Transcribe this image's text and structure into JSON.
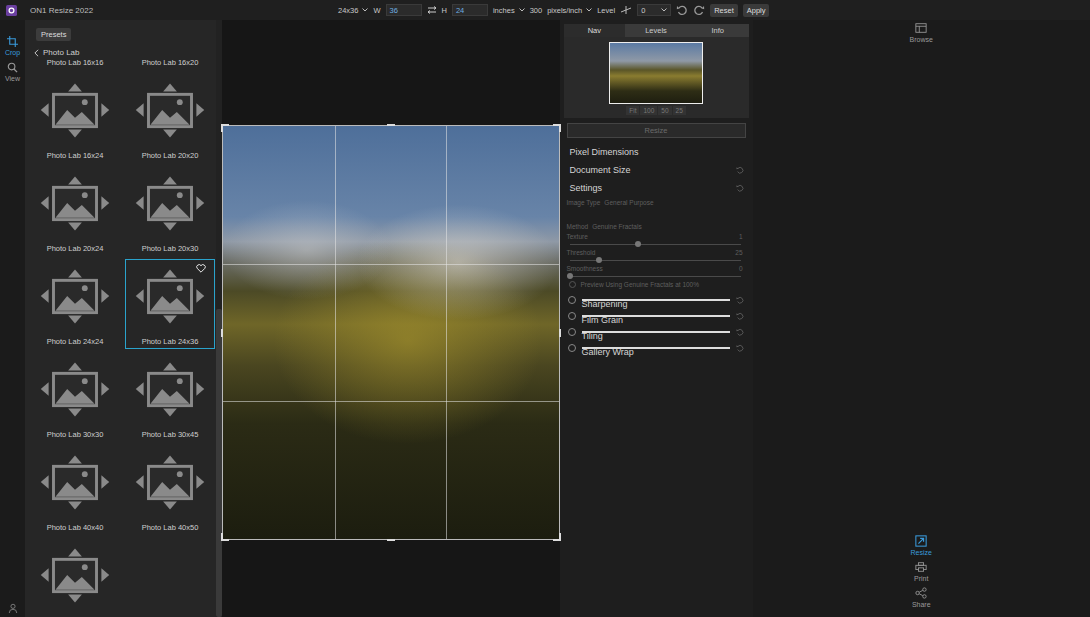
{
  "window": {
    "title": "ON1 Resize 2022"
  },
  "toolbar": {
    "preset": "24x36",
    "width_label": "W",
    "width": "36",
    "height_label": "H",
    "height": "24",
    "units": "inches",
    "resolution": "300",
    "resolution_units": "pixels/inch",
    "level_label": "Level",
    "level": "0",
    "reset": "Reset",
    "apply": "Apply"
  },
  "left_tools": [
    {
      "label": "Crop",
      "selected": true
    },
    {
      "label": "View",
      "selected": false
    }
  ],
  "presets_panel": {
    "button": "Presets",
    "title": "Photo Lab",
    "items": [
      {
        "label": "Photo Lab 16x16",
        "selected": false,
        "favorite": false
      },
      {
        "label": "Photo Lab 16x20",
        "selected": false,
        "favorite": false
      },
      {
        "label": "Photo Lab 16x24",
        "selected": false,
        "favorite": false
      },
      {
        "label": "Photo Lab 20x20",
        "selected": false,
        "favorite": false
      },
      {
        "label": "Photo Lab 20x24",
        "selected": false,
        "favorite": false
      },
      {
        "label": "Photo Lab 20x30",
        "selected": false,
        "favorite": false
      },
      {
        "label": "Photo Lab 24x24",
        "selected": false,
        "favorite": false
      },
      {
        "label": "Photo Lab 24x36",
        "selected": true,
        "favorite": true
      },
      {
        "label": "Photo Lab 30x30",
        "selected": false,
        "favorite": false
      },
      {
        "label": "Photo Lab 30x45",
        "selected": false,
        "favorite": false
      },
      {
        "label": "Photo Lab 40x40",
        "selected": false,
        "favorite": false
      },
      {
        "label": "Photo Lab 40x50",
        "selected": false,
        "favorite": false
      },
      {
        "label": "",
        "selected": false,
        "favorite": false
      }
    ]
  },
  "right_panel": {
    "tabs": [
      {
        "label": "Nav",
        "selected": true
      },
      {
        "label": "Levels",
        "selected": false
      },
      {
        "label": "Info",
        "selected": false
      }
    ],
    "zoom": [
      "Fit",
      "100",
      "50",
      "25"
    ],
    "resize_button": {
      "label": "Resize",
      "disabled": true
    },
    "sections": [
      {
        "title": "Pixel Dimensions",
        "reset": false
      },
      {
        "title": "Document Size",
        "reset": true
      },
      {
        "title": "Settings",
        "reset": true
      }
    ],
    "settings": {
      "image_type_label": "Image Type",
      "image_type": "General Purpose",
      "method_label": "Method",
      "method": "Genuine Fractals",
      "sliders": [
        {
          "label": "Texture",
          "value": "1",
          "level": 0.4
        },
        {
          "label": "Threshold",
          "value": "25",
          "level": 0.17
        },
        {
          "label": "Smoothness",
          "value": "0",
          "level": 0
        }
      ],
      "preview": {
        "label": "Preview Using Genuine Fractals at 100%",
        "checked": false
      }
    },
    "modules": [
      {
        "title": "Sharpening",
        "enabled": false
      },
      {
        "title": "Film Grain",
        "enabled": false
      },
      {
        "title": "Tiling",
        "enabled": false
      },
      {
        "title": "Gallery Wrap",
        "enabled": false
      }
    ]
  },
  "right_tools": [
    {
      "label": "Browse",
      "selected": false
    },
    {
      "label": "Resize",
      "selected": true
    },
    {
      "label": "Print",
      "selected": false
    },
    {
      "label": "Share",
      "selected": false
    }
  ]
}
